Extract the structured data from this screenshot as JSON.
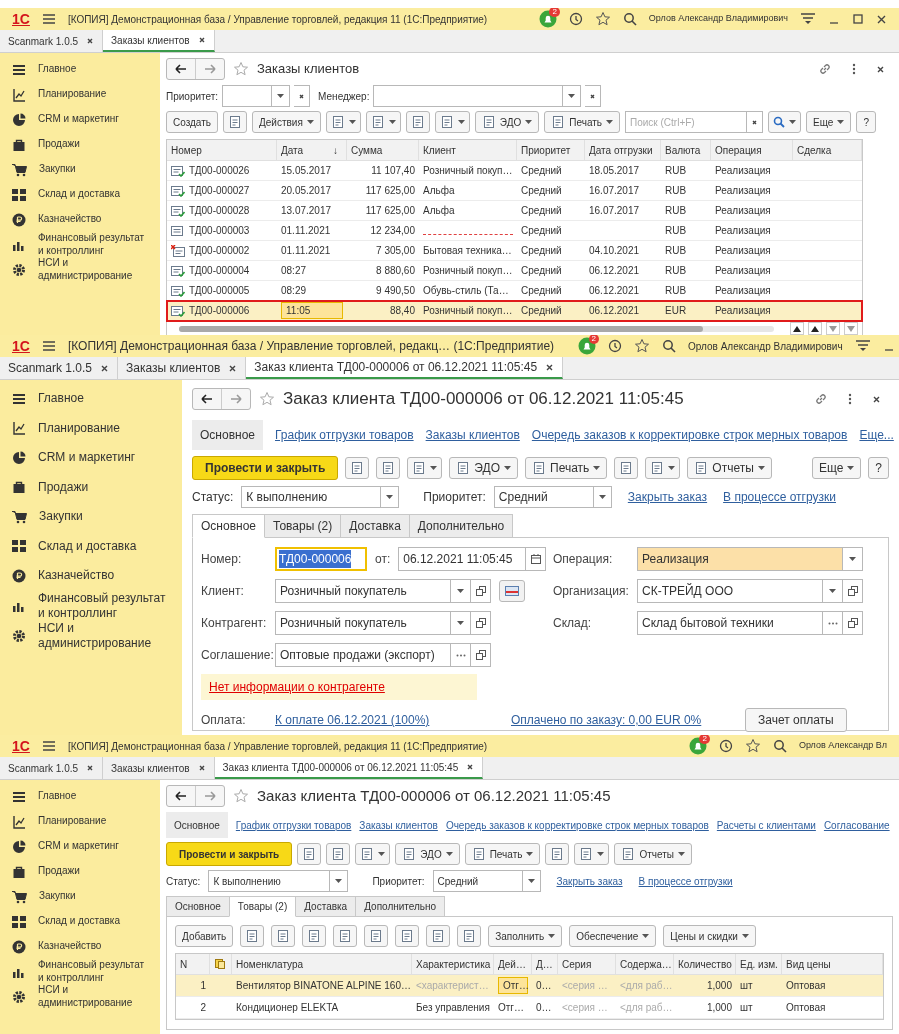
{
  "screens": [
    {
      "kind": "list",
      "app_bar": {
        "logo": "1С",
        "title": "[КОПИЯ] Демонстрационная база / Управление торговлей, редакция 11  (1С:Предприятие)",
        "notifications": "2",
        "user": "Орлов Александр Владимирович",
        "window_controls": true
      },
      "tabs": [
        {
          "label": "Scanmark 1.0.5",
          "selected": false
        },
        {
          "label": "Заказы клиентов",
          "selected": true
        }
      ],
      "sidebar": [
        "Главное",
        "Планирование",
        "CRM и маркетинг",
        "Продажи",
        "Закупки",
        "Склад и доставка",
        "Казначейство",
        "Финансовый результат и контроллинг",
        "НСИ и администрирование"
      ],
      "form": {
        "title": "Заказы клиентов",
        "header_icons": true,
        "filters": [
          {
            "label": "Приоритет:"
          },
          {
            "label": "Менеджер:"
          }
        ],
        "toolbar": [
          {
            "kind": "button",
            "label": "Создать",
            "dropdown": false
          },
          {
            "kind": "icon_button",
            "dropdown": false
          },
          {
            "kind": "button",
            "label": "Действия",
            "dropdown": true
          },
          {
            "kind": "icon_button",
            "dropdown": true
          },
          {
            "kind": "icon_button",
            "dropdown": true
          },
          {
            "kind": "icon_button",
            "dropdown": false
          },
          {
            "kind": "icon_button",
            "dropdown": true
          },
          {
            "kind": "button",
            "label": "ЭДО",
            "icon": true,
            "dropdown": true
          },
          {
            "kind": "button",
            "label": "Печать",
            "icon": true,
            "dropdown": true
          },
          {
            "kind": "search",
            "placeholder": "Поиск (Ctrl+F)"
          },
          {
            "kind": "search_button",
            "dropdown": true
          },
          {
            "kind": "button",
            "label": "Еще",
            "dropdown": true
          },
          {
            "kind": "button",
            "label": "?",
            "dropdown": false
          }
        ],
        "table": {
          "columns": [
            {
              "label": "Номер"
            },
            {
              "label": "Дата",
              "sort_mark": "↓"
            },
            {
              "label": "Сумма"
            },
            {
              "label": "Клиент"
            },
            {
              "label": "Приоритет"
            },
            {
              "label": "Дата отгрузки"
            },
            {
              "label": "Валюта"
            },
            {
              "label": "Операция"
            },
            {
              "label": "Сделка"
            }
          ],
          "rows": [
            {
              "kind": "posted",
              "selected": false,
              "outlined": false,
              "cells": [
                "ТД00-000026",
                "15.05.2017",
                "11 107,40",
                "Розничный покуп…",
                "Средний",
                "18.05.2017",
                "RUB",
                "Реализация"
              ]
            },
            {
              "kind": "posted",
              "selected": false,
              "outlined": false,
              "cells": [
                "ТД00-000027",
                "20.05.2017",
                "117 625,00",
                "Альфа",
                "Средний",
                "16.07.2017",
                "RUB",
                "Реализация"
              ]
            },
            {
              "kind": "posted",
              "selected": false,
              "outlined": false,
              "cells": [
                "ТД00-000028",
                "13.07.2017",
                "117 625,00",
                "Альфа",
                "Средний",
                "16.07.2017",
                "RUB",
                "Реализация"
              ]
            },
            {
              "kind": "draft",
              "selected": false,
              "outlined": false,
              "cells": [
                "ТД00-000003",
                "01.11.2021",
                "12 234,00",
                {
                  "missing": true
                },
                "Средний",
                null,
                "RUB",
                "Реализация"
              ]
            },
            {
              "kind": "deleted",
              "selected": false,
              "outlined": false,
              "cells": [
                "ТД00-000002",
                "01.11.2021",
                "7 305,00",
                "Бытовая техника…",
                "Средний",
                "04.10.2021",
                "RUB",
                "Реализация"
              ]
            },
            {
              "kind": "posted",
              "selected": false,
              "outlined": false,
              "cells": [
                "ТД00-000004",
                "08:27",
                "8 880,60",
                "Розничный покуп…",
                "Средний",
                "06.12.2021",
                "RUB",
                "Реализация"
              ]
            },
            {
              "kind": "posted",
              "selected": false,
              "outlined": false,
              "cells": [
                "ТД00-000005",
                "08:29",
                "9 490,50",
                "Обувь-стиль (Та…",
                "Средний",
                "06.12.2021",
                "RUB",
                "Реализация"
              ]
            },
            {
              "kind": "posted",
              "selected": true,
              "outlined": true,
              "cells": [
                "ТД00-000006",
                {
                  "text": "11:05",
                  "current": true
                },
                "88,40",
                "Розничный покуп…",
                "Средний",
                "06.12.2021",
                "EUR",
                "Реализация"
              ]
            }
          ]
        }
      }
    },
    {
      "kind": "order_main",
      "app_bar": {
        "logo": "1С",
        "title": "[КОПИЯ] Демонстрационная база / Управление торговлей, редакц…  (1С:Предприятие)",
        "notifications": "2",
        "user": "Орлов Александр Владимирович",
        "window_controls": true
      },
      "tabs": [
        {
          "label": "Scanmark 1.0.5",
          "selected": false
        },
        {
          "label": "Заказы клиентов",
          "selected": false
        },
        {
          "label": "Заказ клиента ТД00-000006 от 06.12.2021 11:05:45",
          "selected": true
        }
      ],
      "sidebar": [
        "Главное",
        "Планирование",
        "CRM и маркетинг",
        "Продажи",
        "Закупки",
        "Склад и доставка",
        "Казначейство",
        "Финансовый результат и контроллинг",
        "НСИ и администрирование"
      ],
      "form": {
        "title": "Заказ клиента ТД00-000006 от 06.12.2021 11:05:45",
        "header_icons": true,
        "nav": [
          {
            "label": "Основное",
            "selected": true
          },
          {
            "label": "График отгрузки товаров",
            "selected": false
          },
          {
            "label": "Заказы клиентов",
            "selected": false
          },
          {
            "label": "Очередь заказов к корректировке строк мерных товаров",
            "selected": false
          },
          {
            "label": "Еще...",
            "selected": false,
            "more": true
          }
        ],
        "toolbar": [
          {
            "kind": "primary",
            "label": "Провести и закрыть"
          },
          {
            "kind": "icon_button",
            "dropdown": false
          },
          {
            "kind": "icon_button",
            "dropdown": false
          },
          {
            "kind": "icon_button",
            "dropdown": true
          },
          {
            "kind": "button",
            "label": "ЭДО",
            "icon": true,
            "dropdown": true
          },
          {
            "kind": "button",
            "label": "Печать",
            "icon": true,
            "dropdown": true
          },
          {
            "kind": "icon_button",
            "dropdown": false
          },
          {
            "kind": "icon_button",
            "dropdown": true
          },
          {
            "kind": "button",
            "label": "Отчеты",
            "icon": true,
            "dropdown": true
          },
          {
            "kind": "spacer"
          },
          {
            "kind": "button",
            "label": "Еще",
            "dropdown": true
          },
          {
            "kind": "button",
            "label": "?",
            "dropdown": false
          }
        ],
        "status_row": {
          "status_label": "Статус:",
          "status": "К выполнению",
          "priority_label": "Приоритет:",
          "priority": "Средний",
          "links": [
            "Закрыть заказ",
            "В процессе отгрузки"
          ]
        },
        "page_tabs": [
          {
            "label": "Основное",
            "selected": true
          },
          {
            "label": "Товары (2)",
            "selected": false
          },
          {
            "label": "Доставка",
            "selected": false
          },
          {
            "label": "Дополнительно",
            "selected": false
          }
        ],
        "field_rows": [
          {
            "left": {
              "kind": "number",
              "label": "Номер:",
              "value": "ТД00-000006",
              "focused": true,
              "date_label": "от:",
              "date": "06.12.2021 11:05:45"
            },
            "right": {
              "kind": "select",
              "label": "Операция:",
              "value": "Реализация",
              "highlighted": true
            }
          },
          {
            "left": {
              "kind": "select_open",
              "label": "Клиент:",
              "value": "Розничный покупатель",
              "card": true
            },
            "right": {
              "kind": "select_open",
              "label": "Организация:",
              "value": "СК-ТРЕЙД ООО"
            }
          },
          {
            "left": {
              "kind": "select_open",
              "label": "Контрагент:",
              "value": "Розничный покупатель"
            },
            "right": {
              "kind": "choice_open",
              "label": "Склад:",
              "value": "Склад бытовой техники"
            }
          },
          {
            "left": {
              "kind": "choice_open",
              "label": "Соглашение:",
              "value": "Оптовые продажи (экспорт)"
            }
          }
        ],
        "warning": "Нет информации о контрагенте",
        "payment": {
          "label": "Оплата:",
          "link": "К оплате 06.12.2021 (100%)",
          "paid_link": "Оплачено по заказу: 0,00 EUR 0%",
          "button": "Зачет оплаты"
        }
      }
    },
    {
      "kind": "order_goods",
      "app_bar": {
        "logo": "1С",
        "title": "[КОПИЯ] Демонстрационная база / Управление торговлей, редакция 11  (1С:Предприятие)",
        "notifications": "2",
        "user": "Орлов Александр Вл",
        "window_controls": false
      },
      "tabs": [
        {
          "label": "Scanmark 1.0.5",
          "selected": false
        },
        {
          "label": "Заказы клиентов",
          "selected": false
        },
        {
          "label": "Заказ клиента ТД00-000006 от 06.12.2021 11:05:45",
          "selected": true
        }
      ],
      "sidebar": [
        "Главное",
        "Планирование",
        "CRM и маркетинг",
        "Продажи",
        "Закупки",
        "Склад и доставка",
        "Казначейство",
        "Финансовый результат и контроллинг",
        "НСИ и администрирование"
      ],
      "form": {
        "title": "Заказ клиента ТД00-000006 от 06.12.2021 11:05:45",
        "header_icons": false,
        "nav": [
          {
            "label": "Основное",
            "selected": true
          },
          {
            "label": "График отгрузки товаров",
            "selected": false
          },
          {
            "label": "Заказы клиентов",
            "selected": false
          },
          {
            "label": "Очередь заказов к корректировке строк мерных товаров",
            "selected": false
          },
          {
            "label": "Расчеты с клиентами",
            "selected": false
          },
          {
            "label": "Согласование",
            "selected": false
          }
        ],
        "toolbar": [
          {
            "kind": "primary",
            "label": "Провести и закрыть"
          },
          {
            "kind": "icon_button",
            "dropdown": false
          },
          {
            "kind": "icon_button",
            "dropdown": false
          },
          {
            "kind": "icon_button",
            "dropdown": true
          },
          {
            "kind": "button",
            "label": "ЭДО",
            "icon": true,
            "dropdown": true
          },
          {
            "kind": "button",
            "label": "Печать",
            "icon": true,
            "dropdown": true
          },
          {
            "kind": "icon_button",
            "dropdown": false
          },
          {
            "kind": "icon_button",
            "dropdown": true
          },
          {
            "kind": "button",
            "label": "Отчеты",
            "icon": true,
            "dropdown": true
          }
        ],
        "status_row": {
          "status_label": "Статус:",
          "status": "К выполнению",
          "priority_label": "Приоритет:",
          "priority": "Средний",
          "links": [
            "Закрыть заказ",
            "В процессе отгрузки"
          ]
        },
        "page_tabs": [
          {
            "label": "Основное",
            "selected": false
          },
          {
            "label": "Товары (2)",
            "selected": true
          },
          {
            "label": "Доставка",
            "selected": false
          },
          {
            "label": "Дополнительно",
            "selected": false
          }
        ],
        "goods_toolbar": [
          {
            "kind": "button",
            "label": "Добавить",
            "dropdown": false
          },
          {
            "kind": "icon_button",
            "dropdown": false
          },
          {
            "kind": "icon_button",
            "dropdown": false
          },
          {
            "kind": "icon_button",
            "dropdown": false
          },
          {
            "kind": "icon_button",
            "dropdown": false
          },
          {
            "kind": "icon_button",
            "dropdown": false
          },
          {
            "kind": "icon_button",
            "dropdown": false
          },
          {
            "kind": "icon_button",
            "dropdown": false
          },
          {
            "kind": "icon_button",
            "dropdown": false
          },
          {
            "kind": "button",
            "label": "Заполнить",
            "dropdown": true
          },
          {
            "kind": "button",
            "label": "Обеспечение",
            "dropdown": true
          },
          {
            "kind": "button",
            "label": "Цены и скидки",
            "dropdown": true
          }
        ],
        "table": {
          "columns": [
            {
              "label": "N"
            },
            {
              "kind": "icon"
            },
            {
              "label": "Номенклатура"
            },
            {
              "label": "Характеристика"
            },
            {
              "label": "Дей…"
            },
            {
              "label": "Д…"
            },
            {
              "label": "Серия"
            },
            {
              "label": "Содержа…"
            },
            {
              "label": "Количество"
            },
            {
              "label": "Ед. изм."
            },
            {
              "label": "Вид цены"
            }
          ],
          "rows": [
            {
              "selected": true,
              "cells": [
                "1",
                null,
                "Вентилятор BINATONE ALPINE 160…",
                {
                  "text": "<характерист…",
                  "placeholder": true
                },
                {
                  "text": "Отг…",
                  "current": true
                },
                "0…",
                {
                  "text": "<серия …",
                  "placeholder": true
                },
                {
                  "text": "<для раб…",
                  "placeholder": true
                },
                "1,000",
                "шт",
                "Оптовая"
              ]
            },
            {
              "selected": false,
              "cells": [
                "2",
                null,
                "Кондиционер ELEKTA",
                "Без управления",
                "Отг…",
                "0…",
                {
                  "text": "<серия …",
                  "placeholder": true
                },
                {
                  "text": "<для раб…",
                  "placeholder": true
                },
                "1,000",
                "шт",
                "Оптовая"
              ]
            }
          ]
        }
      }
    }
  ]
}
